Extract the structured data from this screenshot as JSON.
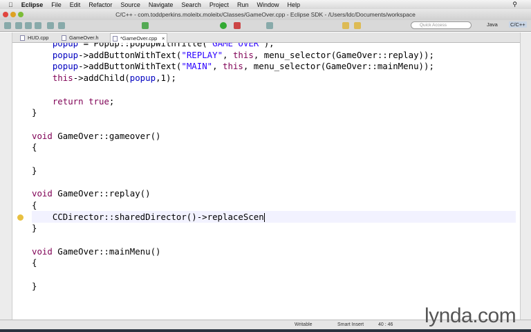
{
  "menubar": {
    "app": "Eclipse",
    "items": [
      "File",
      "Edit",
      "Refactor",
      "Source",
      "Navigate",
      "Search",
      "Project",
      "Run",
      "Window",
      "Help"
    ]
  },
  "window": {
    "title": "C/C++ - com.toddperkins.moleitx.moleitx/Classes/GameOver.cpp - Eclipse SDK - /Users/ldc/Documents/workspace"
  },
  "toolbar": {
    "quick_access_placeholder": "Quick Access",
    "perspectives": [
      "Java",
      "C/C++"
    ]
  },
  "tabs": [
    {
      "label": "HUD.cpp"
    },
    {
      "label": "GameOver.h"
    },
    {
      "label": "*GameOver.cpp",
      "active": true
    }
  ],
  "code": [
    "    popup = Popup::popupWithTitle(\"GAME OVER\");",
    "    popup->addButtonWithText(\"REPLAY\", this, menu_selector(GameOver::replay));",
    "    popup->addButtonWithText(\"MAIN\", this, menu_selector(GameOver::mainMenu));",
    "    this->addChild(popup,1);",
    "",
    "    return true;",
    "}",
    "",
    "void GameOver::gameover()",
    "{",
    "",
    "}",
    "",
    "void GameOver::replay()",
    "{",
    "    CCDirector::sharedDirector()->replaceScen",
    "}",
    "",
    "void GameOver::mainMenu()",
    "{",
    "",
    "}"
  ],
  "status": {
    "mode": "Writable",
    "insert": "Smart Insert",
    "position": "40 : 46"
  },
  "watermark": "lynda.com"
}
